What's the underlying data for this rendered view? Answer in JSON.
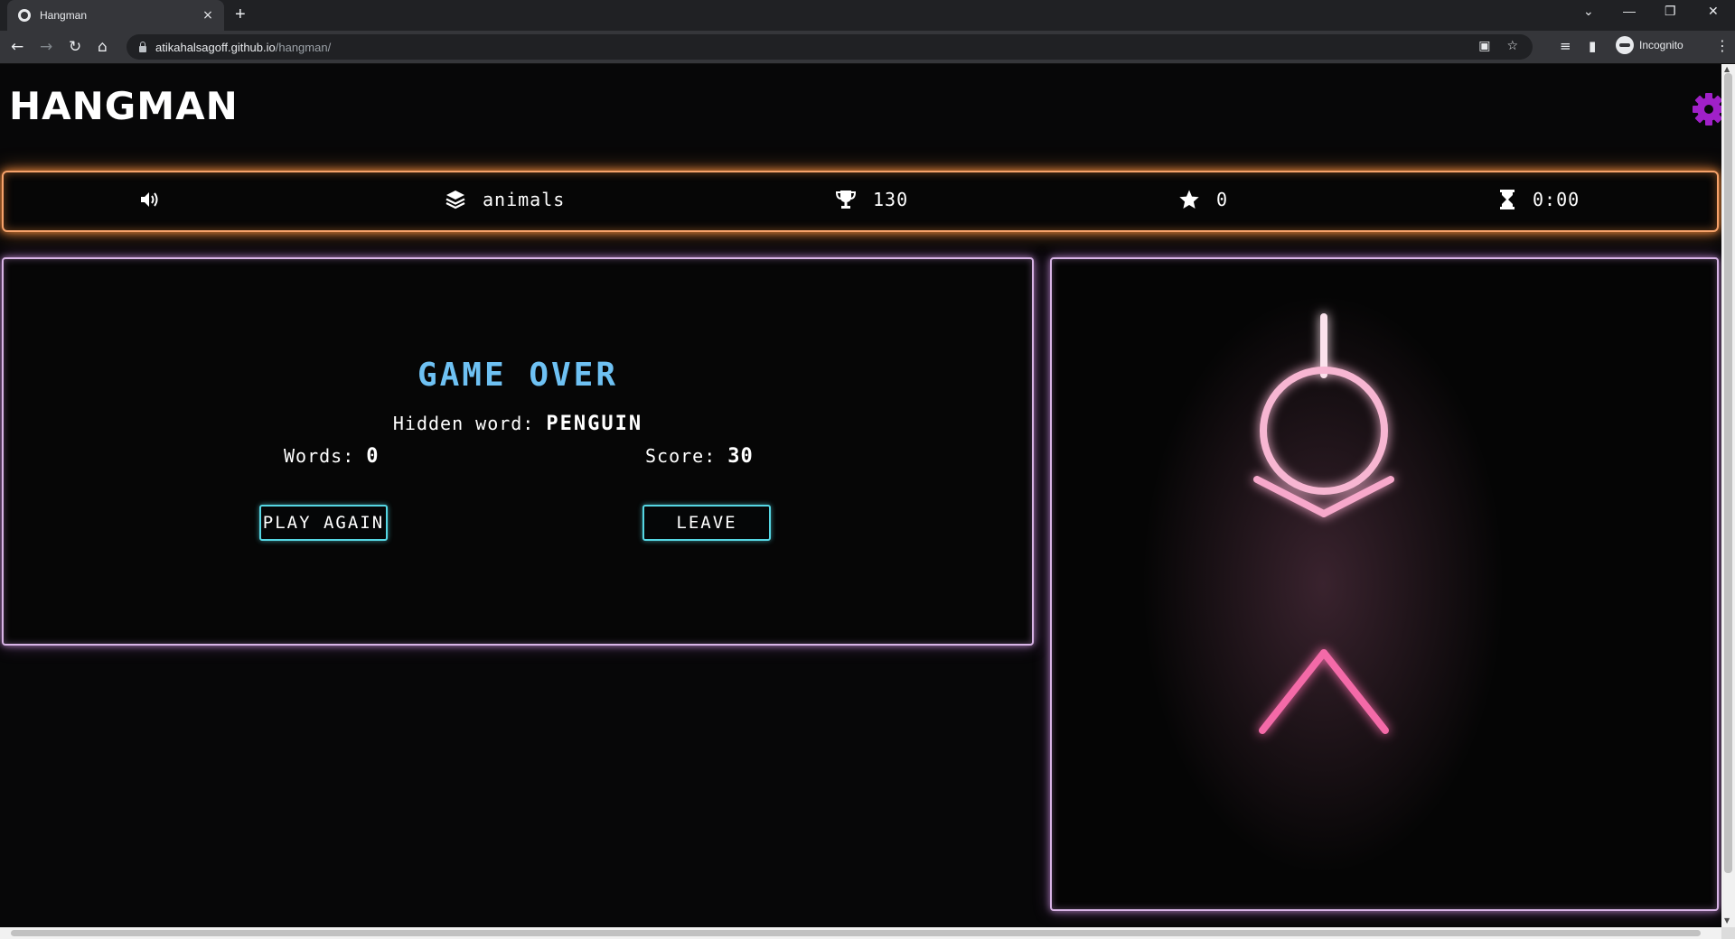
{
  "browser": {
    "tab_title": "Hangman",
    "tab_close": "×",
    "new_tab": "+",
    "url_host": "atikahalsagoff.github.io",
    "url_path": "/hangman/",
    "profile_label": "Incognito",
    "window_controls": [
      "⌄",
      "—",
      "❐",
      "✕"
    ]
  },
  "header": {
    "logo": "HANGMAN",
    "settings_icon": "gear-icon"
  },
  "stats": {
    "sound_icon": "speaker-icon",
    "category": "animals",
    "high_score": "130",
    "stars": "0",
    "timer": "0:00"
  },
  "game_over": {
    "title": "GAME OVER",
    "hidden_word_label": "Hidden word:",
    "hidden_word": "PENGUIN",
    "words_label": "Words:",
    "words_value": "0",
    "score_label": "Score:",
    "score_value": "30",
    "play_again": "PLAY AGAIN",
    "leave": "LEAVE"
  },
  "colors": {
    "stats_border": "#f6a26a",
    "panel_border": "#d8b4e6",
    "title": "#6ec1f3",
    "button_border": "#55d6e3",
    "gear": "#a020c8",
    "figure": "#f48cbf"
  }
}
